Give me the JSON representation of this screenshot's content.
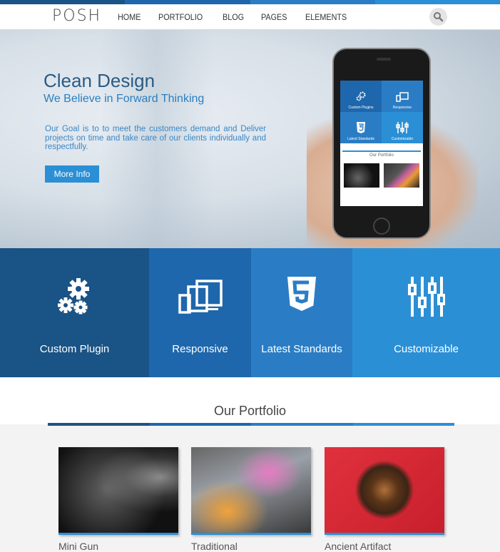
{
  "brand": {
    "logo": "POSH"
  },
  "nav": {
    "items": [
      "HOME",
      "PORTFOLIO",
      "BLOG",
      "PAGES",
      "ELEMENTS"
    ]
  },
  "colors": {
    "dark_blue": "#1a5385",
    "mid_blue": "#1f67ac",
    "blue": "#2a7dc5",
    "light_blue": "#2b8fd6",
    "hero_title": "#2b5b84"
  },
  "hero": {
    "title": "Clean Design",
    "subtitle": "We Believe in Forward Thinking",
    "body": "Our Goal is to to meet the customers demand and Deliver projects on time and take care of our clients individually and respectfully.",
    "button": "More Info",
    "phone": {
      "tiles": [
        "Custom Plugins",
        "Responsive",
        "Latest Standards",
        "Customizable"
      ],
      "portfolio_label": "Our Portfolio"
    }
  },
  "features": [
    {
      "label": "Custom Plugin",
      "icon": "gears-icon"
    },
    {
      "label": "Responsive",
      "icon": "devices-icon"
    },
    {
      "label": "Latest Standards",
      "icon": "html5-icon"
    },
    {
      "label": "Customizable",
      "icon": "sliders-icon"
    }
  ],
  "portfolio": {
    "title": "Our Portfolio",
    "items": [
      {
        "caption": "Mini Gun"
      },
      {
        "caption": "Traditional"
      },
      {
        "caption": "Ancient Artifact"
      }
    ]
  }
}
